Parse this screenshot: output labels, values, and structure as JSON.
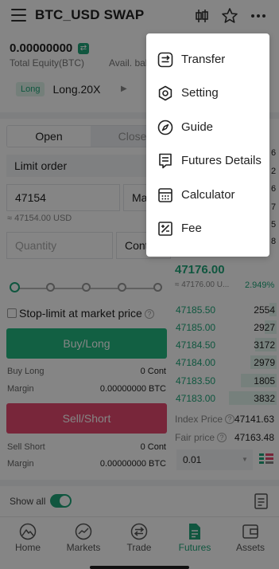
{
  "header": {
    "title": "BTC_USD SWAP"
  },
  "account": {
    "equity_value": "0.00000000",
    "equity_label": "Total Equity(BTC)",
    "avail_label": "Avail. bal",
    "position_side": "Long",
    "leverage": "Long.20X"
  },
  "order_form": {
    "tab_open": "Open",
    "tab_close": "Close",
    "order_type": "Limit order",
    "price_value": "47154",
    "price_unit_label": "Mar",
    "price_usd": "≈ 47154.00 USD",
    "quantity_placeholder": "Quantity",
    "quantity_unit_label": "Cont",
    "stop_limit_label": "Stop-limit at market price",
    "buy_button": "Buy/Long",
    "buy_long_label": "Buy Long",
    "buy_long_value": "0 Cont",
    "buy_margin_label": "Margin",
    "buy_margin_value": "0.00000000 BTC",
    "sell_button": "Sell/Short",
    "sell_short_label": "Sell Short",
    "sell_short_value": "0 Cont",
    "sell_margin_label": "Margin",
    "sell_margin_value": "0.00000000 BTC"
  },
  "orderbook": {
    "ask_partials": [
      "6",
      "2",
      "6",
      "7",
      "5",
      "8"
    ],
    "mid_price": "47176.00",
    "mid_usd": "≈ 47176.00 U...",
    "mid_change": "2.949%",
    "bids": [
      {
        "price": "47185.50",
        "qty": "2554",
        "depth": 0.15
      },
      {
        "price": "47185.00",
        "qty": "2927",
        "depth": 0.25
      },
      {
        "price": "47184.50",
        "qty": "3172",
        "depth": 0.45
      },
      {
        "price": "47184.00",
        "qty": "2979",
        "depth": 0.55
      },
      {
        "price": "47183.50",
        "qty": "1805",
        "depth": 0.75
      },
      {
        "price": "47183.00",
        "qty": "3832",
        "depth": 1.0
      }
    ],
    "index_price_label": "Index Price",
    "index_price_value": "47141.63",
    "fair_price_label": "Fair price",
    "fair_price_value": "47163.48",
    "price_step": "0.01"
  },
  "footer": {
    "show_all_label": "Show all"
  },
  "bottom_nav": [
    {
      "label": "Home",
      "icon": "home-icon"
    },
    {
      "label": "Markets",
      "icon": "markets-icon"
    },
    {
      "label": "Trade",
      "icon": "trade-icon"
    },
    {
      "label": "Futures",
      "icon": "futures-icon",
      "active": true
    },
    {
      "label": "Assets",
      "icon": "assets-icon"
    }
  ],
  "menu": [
    {
      "label": "Transfer",
      "icon": "transfer-icon"
    },
    {
      "label": "Setting",
      "icon": "gear-icon"
    },
    {
      "label": "Guide",
      "icon": "compass-icon"
    },
    {
      "label": "Futures Details",
      "icon": "document-icon"
    },
    {
      "label": "Calculator",
      "icon": "calculator-icon"
    },
    {
      "label": "Fee",
      "icon": "fee-icon"
    }
  ],
  "colors": {
    "accent_green": "#1fa67a",
    "buy_green": "#23b881",
    "sell_red": "#e64a6f",
    "overlay": "rgba(0,0,0,0.48)"
  }
}
